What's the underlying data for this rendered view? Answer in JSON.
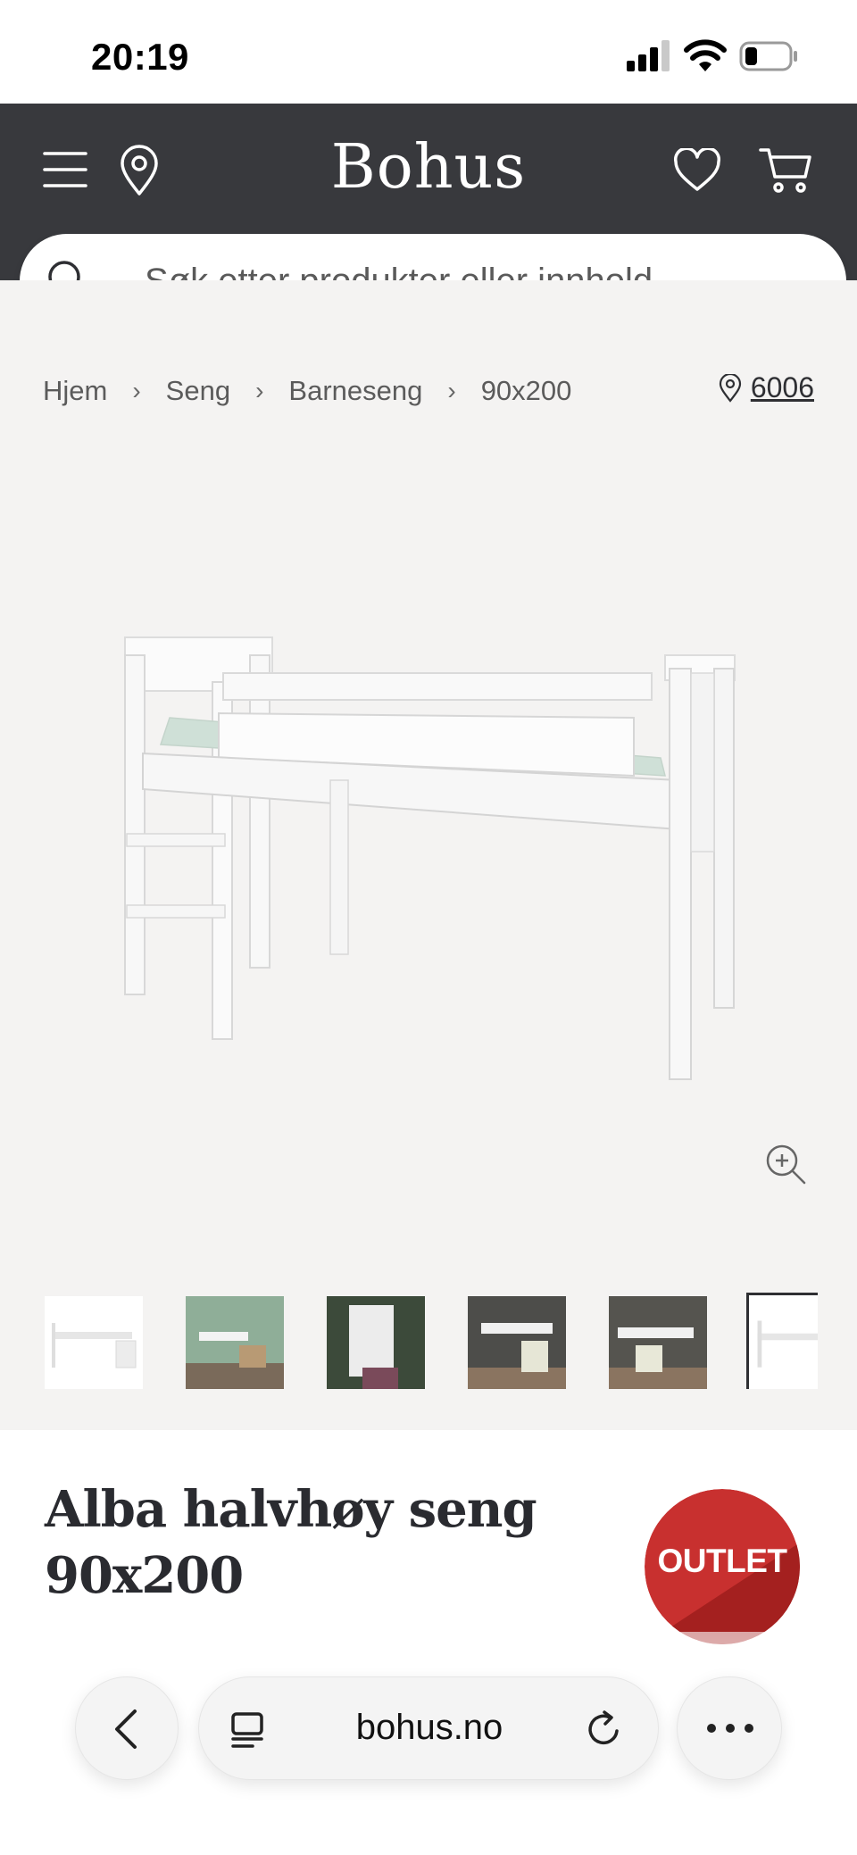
{
  "status_bar": {
    "time": "20:19"
  },
  "header": {
    "logo": "Bohus",
    "background": "#38393d"
  },
  "search": {
    "placeholder": "Søk etter produkter eller innhold..."
  },
  "breadcrumb": [
    "Hjem",
    "Seng",
    "Barneseng",
    "90x200"
  ],
  "store": {
    "number": "6006"
  },
  "gallery": {
    "thumbnail_count": 6,
    "active_index": 5
  },
  "product": {
    "title_line1": "Alba halvhøy seng",
    "title_line2": "90x200",
    "badge": "OUTLET"
  },
  "browser": {
    "url": "bohus.no"
  },
  "colors": {
    "page_bg": "#f4f3f2",
    "badge_red": "#c8302f",
    "text_dark": "#2e2f33"
  }
}
